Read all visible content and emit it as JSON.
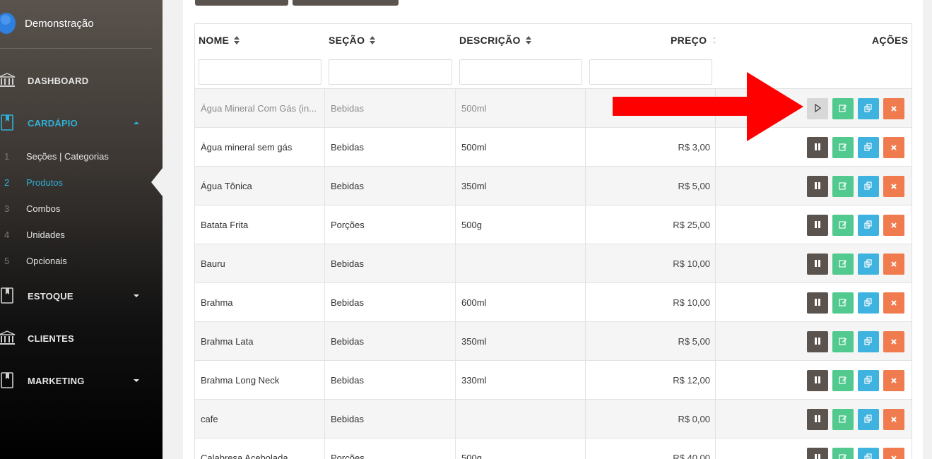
{
  "user": {
    "name": "Demonstração"
  },
  "sidebar": {
    "items": [
      {
        "label": "DASHBOARD",
        "icon": "bank-icon"
      },
      {
        "label": "CARDÁPIO",
        "icon": "book-icon"
      },
      {
        "label": "ESTOQUE",
        "icon": "book-icon"
      },
      {
        "label": "CLIENTES",
        "icon": "bank-icon"
      },
      {
        "label": "MARKETING",
        "icon": "book-icon"
      }
    ],
    "sub_items": [
      {
        "num": "1",
        "label": "Seções | Categorias"
      },
      {
        "num": "2",
        "label": "Produtos"
      },
      {
        "num": "3",
        "label": "Combos"
      },
      {
        "num": "4",
        "label": "Unidades"
      },
      {
        "num": "5",
        "label": "Opcionais"
      }
    ]
  },
  "table": {
    "columns": [
      "NOME",
      "SEÇÃO",
      "DESCRIÇÃO",
      "PREÇO",
      "AÇÕES"
    ],
    "rows": [
      {
        "nome": "Água Mineral Com Gás (in...",
        "secao": "Bebidas",
        "descricao": "500ml",
        "preco": "",
        "status": "paused"
      },
      {
        "nome": "Àgua mineral sem gás",
        "secao": "Bebidas",
        "descricao": "500ml",
        "preco": "R$ 3,00",
        "status": "active"
      },
      {
        "nome": "Água Tônica",
        "secao": "Bebidas",
        "descricao": "350ml",
        "preco": "R$ 5,00",
        "status": "active"
      },
      {
        "nome": "Batata Frita",
        "secao": "Porções",
        "descricao": "500g",
        "preco": "R$ 25,00",
        "status": "active"
      },
      {
        "nome": "Bauru",
        "secao": "Bebidas",
        "descricao": "",
        "preco": "R$ 10,00",
        "status": "active"
      },
      {
        "nome": "Brahma",
        "secao": "Bebidas",
        "descricao": "600ml",
        "preco": "R$ 10,00",
        "status": "active"
      },
      {
        "nome": "Brahma Lata",
        "secao": "Bebidas",
        "descricao": "350ml",
        "preco": "R$ 5,00",
        "status": "active"
      },
      {
        "nome": "Brahma Long Neck",
        "secao": "Bebidas",
        "descricao": "330ml",
        "preco": "R$ 12,00",
        "status": "active"
      },
      {
        "nome": "cafe",
        "secao": "Bebidas",
        "descricao": "",
        "preco": "R$ 0,00",
        "status": "active"
      },
      {
        "nome": "Calabresa Acebolada",
        "secao": "Porções",
        "descricao": "500g",
        "preco": "R$ 40,00",
        "status": "active"
      }
    ]
  },
  "colors": {
    "accent": "#2fb0d9",
    "pause_button": "#5b534d",
    "edit_button": "#52c98f",
    "copy_button": "#3eb3df",
    "delete_button": "#f07b4e",
    "annotation_arrow": "#ff0000"
  }
}
